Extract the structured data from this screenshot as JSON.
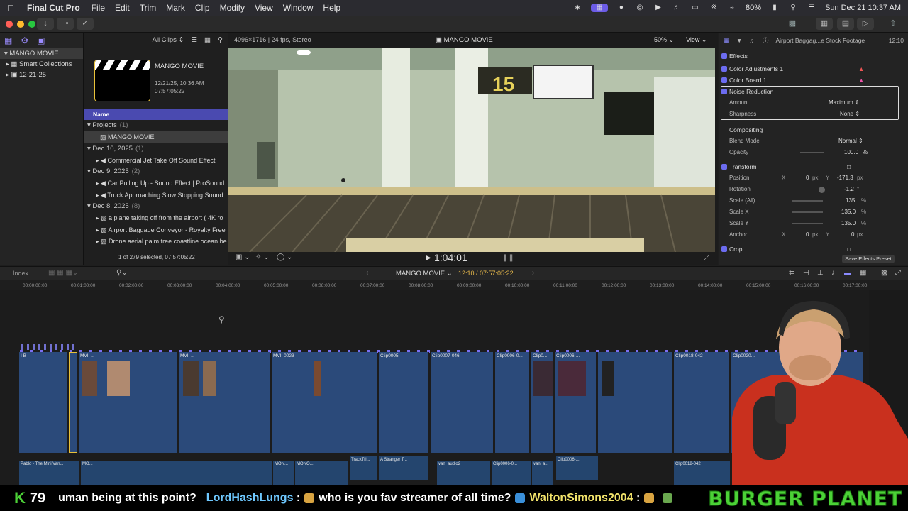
{
  "menubar": {
    "app": "Final Cut Pro",
    "items": [
      "File",
      "Edit",
      "Trim",
      "Mark",
      "Clip",
      "Modify",
      "View",
      "Window",
      "Help"
    ],
    "battery": "80%",
    "datetime": "Sun Dec 21  10:37 AM"
  },
  "library": {
    "items": [
      {
        "label": "MANGO MOVIE",
        "selected": true
      },
      {
        "label": "Smart Collections",
        "selected": false
      },
      {
        "label": "12-21-25",
        "selected": false
      }
    ]
  },
  "browser": {
    "filter": "All Clips",
    "project_title": "MANGO MOVIE",
    "project_date": "12/21/25, 10:36 AM",
    "project_duration": "07:57:05:22",
    "column_name": "Name",
    "rows": [
      {
        "label": "Projects",
        "count": "(1)",
        "kind": "group"
      },
      {
        "label": "MANGO MOVIE",
        "count": "",
        "kind": "item-selected"
      },
      {
        "label": "Dec 10, 2025",
        "count": "(1)",
        "kind": "group"
      },
      {
        "label": "Commercial Jet Take Off Sound Effect",
        "count": "",
        "kind": "item"
      },
      {
        "label": "Dec 9, 2025",
        "count": "(2)",
        "kind": "group"
      },
      {
        "label": "Car Pulling Up - Sound Effect  |  ProSound",
        "count": "",
        "kind": "item"
      },
      {
        "label": "Truck Approaching Slow Stopping Sound",
        "count": "",
        "kind": "item"
      },
      {
        "label": "Dec 8, 2025",
        "count": "(8)",
        "kind": "group"
      },
      {
        "label": "a plane taking off from the airport ( 4K ro",
        "count": "",
        "kind": "item"
      },
      {
        "label": "Airport Baggage Conveyor - Royalty Free",
        "count": "",
        "kind": "item"
      },
      {
        "label": "Drone aerial palm tree coastline ocean be",
        "count": "",
        "kind": "item"
      }
    ],
    "footer": "1 of 279 selected, 07:57:05:22"
  },
  "viewer": {
    "format": "4096×1716 | 24 fps, Stereo",
    "title": "MANGO MOVIE",
    "zoom": "50%",
    "view_menu": "View",
    "timecode": "1:04:01",
    "sign_number": "15"
  },
  "inspector": {
    "clip_name": "Airport Baggag...e Stock Footage",
    "duration": "12:10",
    "effects_label": "Effects",
    "color_adjust": "Color Adjustments 1",
    "color_board": "Color Board 1",
    "noise_reduction": "Noise Reduction",
    "amount_label": "Amount",
    "amount_value": "Maximum",
    "sharpness_label": "Sharpness",
    "sharpness_value": "None",
    "compositing": "Compositing",
    "blend_label": "Blend Mode",
    "blend_value": "Normal",
    "opacity_label": "Opacity",
    "opacity_value": "100.0",
    "percent": "%",
    "transform": "Transform",
    "position_label": "Position",
    "x": "X",
    "y": "Y",
    "px": "px",
    "position_x": "0",
    "position_y": "-171.3",
    "rotation_label": "Rotation",
    "rotation_value": "-1.2",
    "degree": "°",
    "scale_all_label": "Scale (All)",
    "scale_all_value": "135",
    "scale_x_label": "Scale X",
    "scale_x_value": "135.0",
    "scale_y_label": "Scale Y",
    "scale_y_value": "135.0",
    "anchor_label": "Anchor",
    "anchor_x": "0",
    "anchor_y": "0",
    "crop": "Crop",
    "save_preset": "Save Effects Preset"
  },
  "timeline": {
    "index_label": "Index",
    "project": "MANGO MOVIE",
    "position": "12:10 / 07:57:05:22",
    "ticks": [
      "00:00:00:00",
      "00:01:00:00",
      "00:02:00:00",
      "00:03:00:00",
      "00:04:00:00",
      "00:05:00:00",
      "00:06:00:00",
      "00:07:00:00",
      "00:08:00:00",
      "00:09:00:00",
      "00:10:00:00",
      "00:11:00:00",
      "00:12:00:00",
      "00:13:00:00",
      "00:14:00:00",
      "00:15:00:00",
      "00:16:00:00",
      "00:17:00:00"
    ],
    "clips": [
      "MVI_...",
      "MVI_...",
      "MVI_0023",
      "Clip0005",
      "Clip0007-046",
      "Clip0006-0...",
      "Clip0...",
      "Clip0006-...",
      "Clip0018-042",
      "Clip0020..."
    ],
    "audio_clips": [
      "Pablo - The Mini Van...",
      "MO...",
      "MON...",
      "MONO...",
      "TrackTri...",
      "A Stranger T...",
      "van_audio2",
      "Clip0006-0...",
      "van_a...",
      "Clip0006-...",
      "Clip0018-042"
    ]
  },
  "chat": {
    "k_label": "K",
    "k_count": "79",
    "line1": "uman being at this point?",
    "user1": "LordHashLungs",
    "line2": "who is you fav streamer of all time?",
    "user2": "WaltonSimons2004",
    "brand": "BURGER PLANET"
  }
}
